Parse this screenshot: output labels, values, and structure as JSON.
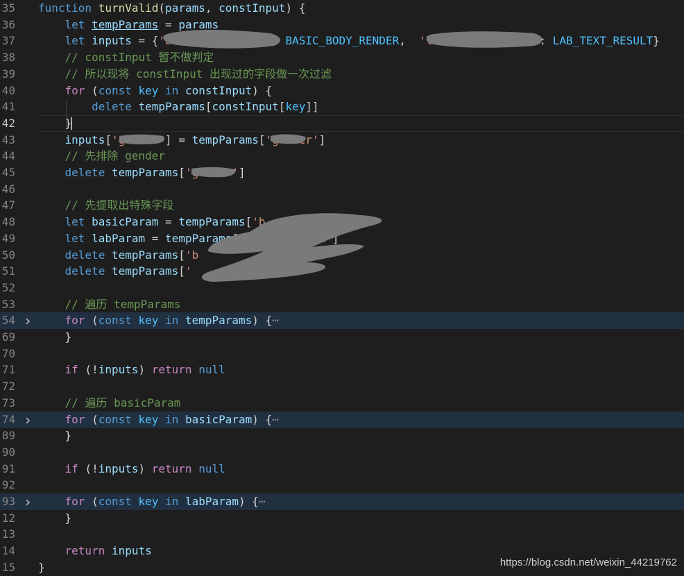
{
  "editor": {
    "lines": [
      {
        "no": "35",
        "tokens": [
          {
            "t": "function",
            "c": "kw"
          },
          {
            "t": " "
          },
          {
            "t": "turnValid",
            "c": "fn"
          },
          {
            "t": "("
          },
          {
            "t": "params",
            "c": "var"
          },
          {
            "t": ", "
          },
          {
            "t": "constInput",
            "c": "var"
          },
          {
            "t": ") {"
          }
        ]
      },
      {
        "no": "36",
        "tokens": [
          {
            "t": "    "
          },
          {
            "t": "let",
            "c": "kw"
          },
          {
            "t": " "
          },
          {
            "t": "tempParams",
            "c": "var",
            "u": true
          },
          {
            "t": " = "
          },
          {
            "t": "params",
            "c": "var"
          }
        ]
      },
      {
        "no": "37",
        "tokens": [
          {
            "t": "    "
          },
          {
            "t": "let",
            "c": "kw"
          },
          {
            "t": " "
          },
          {
            "t": "inputs",
            "c": "var"
          },
          {
            "t": " = {"
          },
          {
            "t": "'ba",
            "c": "str"
          },
          {
            "t": "              "
          },
          {
            "t": ": "
          },
          {
            "t": "BASIC_BODY_RENDER",
            "c": "cst"
          },
          {
            "t": ",  "
          },
          {
            "t": "'la",
            "c": "str"
          },
          {
            "t": "            "
          },
          {
            "t": "lt'",
            "c": "str"
          },
          {
            "t": ": "
          },
          {
            "t": "LAB_TEXT_RESULT",
            "c": "cst"
          },
          {
            "t": "}"
          }
        ]
      },
      {
        "no": "38",
        "tokens": [
          {
            "t": "    "
          },
          {
            "t": "// constInput 暂不做判定",
            "c": "cm"
          }
        ]
      },
      {
        "no": "39",
        "tokens": [
          {
            "t": "    "
          },
          {
            "t": "// 所以现将 constInput 出现过的字段做一次过滤",
            "c": "cm"
          }
        ]
      },
      {
        "no": "40",
        "tokens": [
          {
            "t": "    "
          },
          {
            "t": "for",
            "c": "ctl"
          },
          {
            "t": " ("
          },
          {
            "t": "const",
            "c": "kw"
          },
          {
            "t": " "
          },
          {
            "t": "key",
            "c": "cst"
          },
          {
            "t": " "
          },
          {
            "t": "in",
            "c": "kw"
          },
          {
            "t": " "
          },
          {
            "t": "constInput",
            "c": "var"
          },
          {
            "t": ") {"
          }
        ]
      },
      {
        "no": "41",
        "tokens": [
          {
            "t": "        "
          },
          {
            "t": "delete",
            "c": "kw"
          },
          {
            "t": " "
          },
          {
            "t": "tempParams",
            "c": "var"
          },
          {
            "t": "["
          },
          {
            "t": "constInput",
            "c": "var"
          },
          {
            "t": "["
          },
          {
            "t": "key",
            "c": "cst"
          },
          {
            "t": "]]"
          }
        ]
      },
      {
        "no": "42",
        "current": true,
        "tokens": [
          {
            "t": "    "
          },
          {
            "t": "}"
          },
          {
            "t": "",
            "cursor": true
          }
        ]
      },
      {
        "no": "43",
        "tokens": [
          {
            "t": "    "
          },
          {
            "t": "inputs",
            "c": "var"
          },
          {
            "t": "["
          },
          {
            "t": "'g",
            "c": "str"
          },
          {
            "t": "     "
          },
          {
            "t": "'",
            "c": "str"
          },
          {
            "t": "] = "
          },
          {
            "t": "tempParams",
            "c": "var"
          },
          {
            "t": "["
          },
          {
            "t": "'g",
            "c": "str"
          },
          {
            "t": "   "
          },
          {
            "t": "er'",
            "c": "str"
          },
          {
            "t": "]"
          }
        ]
      },
      {
        "no": "44",
        "tokens": [
          {
            "t": "    "
          },
          {
            "t": "// 先排除 gender",
            "c": "cm"
          }
        ]
      },
      {
        "no": "45",
        "tokens": [
          {
            "t": "    "
          },
          {
            "t": "delete",
            "c": "kw"
          },
          {
            "t": " "
          },
          {
            "t": "tempParams",
            "c": "var"
          },
          {
            "t": "["
          },
          {
            "t": "'ge",
            "c": "str"
          },
          {
            "t": "    "
          },
          {
            "t": "'",
            "c": "str"
          },
          {
            "t": "]"
          }
        ]
      },
      {
        "no": "46",
        "tokens": []
      },
      {
        "no": "47",
        "tokens": [
          {
            "t": "    "
          },
          {
            "t": "// 先提取出特殊字段",
            "c": "cm"
          }
        ]
      },
      {
        "no": "48",
        "tokens": [
          {
            "t": "    "
          },
          {
            "t": "let",
            "c": "kw"
          },
          {
            "t": " "
          },
          {
            "t": "basicParam",
            "c": "var"
          },
          {
            "t": " = "
          },
          {
            "t": "tempParams",
            "c": "var"
          },
          {
            "t": "["
          },
          {
            "t": "'b",
            "c": "str"
          },
          {
            "t": "           "
          },
          {
            "t": "r'",
            "c": "str"
          },
          {
            "t": "]"
          }
        ]
      },
      {
        "no": "49",
        "tokens": [
          {
            "t": "    "
          },
          {
            "t": "let",
            "c": "kw"
          },
          {
            "t": " "
          },
          {
            "t": "labParam",
            "c": "var"
          },
          {
            "t": " = "
          },
          {
            "t": "tempParams",
            "c": "var"
          },
          {
            "t": "["
          },
          {
            "t": "'l",
            "c": "str"
          },
          {
            "t": "         "
          },
          {
            "t": "lt'",
            "c": "str"
          },
          {
            "t": "]"
          }
        ]
      },
      {
        "no": "50",
        "tokens": [
          {
            "t": "    "
          },
          {
            "t": "delete",
            "c": "kw"
          },
          {
            "t": " "
          },
          {
            "t": "tempParams",
            "c": "var"
          },
          {
            "t": "["
          },
          {
            "t": "'b",
            "c": "str"
          },
          {
            "t": "           "
          },
          {
            "t": "'",
            "c": "str"
          },
          {
            "t": "]"
          }
        ]
      },
      {
        "no": "51",
        "tokens": [
          {
            "t": "    "
          },
          {
            "t": "delete",
            "c": "kw"
          },
          {
            "t": " "
          },
          {
            "t": "tempParams",
            "c": "var"
          },
          {
            "t": "["
          },
          {
            "t": "'",
            "c": "str"
          },
          {
            "t": "         "
          },
          {
            "t": "t'",
            "c": "str"
          },
          {
            "t": "]"
          }
        ]
      },
      {
        "no": "52",
        "tokens": []
      },
      {
        "no": "53",
        "tokens": [
          {
            "t": "    "
          },
          {
            "t": "// 遍历 tempParams",
            "c": "cm"
          }
        ]
      },
      {
        "no": "54",
        "folded": true,
        "tokens": [
          {
            "t": "    "
          },
          {
            "t": "for",
            "c": "ctl"
          },
          {
            "t": " ("
          },
          {
            "t": "const",
            "c": "kw"
          },
          {
            "t": " "
          },
          {
            "t": "key",
            "c": "cst"
          },
          {
            "t": " "
          },
          {
            "t": "in",
            "c": "kw"
          },
          {
            "t": " "
          },
          {
            "t": "tempParams",
            "c": "var"
          },
          {
            "t": ") {"
          },
          {
            "t": "⋯",
            "c": "ellip"
          }
        ]
      },
      {
        "no": "69",
        "tokens": [
          {
            "t": "    "
          },
          {
            "t": "}"
          }
        ]
      },
      {
        "no": "70",
        "tokens": []
      },
      {
        "no": "71",
        "tokens": [
          {
            "t": "    "
          },
          {
            "t": "if",
            "c": "ctl"
          },
          {
            "t": " (!"
          },
          {
            "t": "inputs",
            "c": "var"
          },
          {
            "t": ") "
          },
          {
            "t": "return",
            "c": "ctl"
          },
          {
            "t": " "
          },
          {
            "t": "null",
            "c": "kw"
          }
        ]
      },
      {
        "no": "72",
        "tokens": []
      },
      {
        "no": "73",
        "tokens": [
          {
            "t": "    "
          },
          {
            "t": "// 遍历 basicParam",
            "c": "cm"
          }
        ]
      },
      {
        "no": "74",
        "folded": true,
        "tokens": [
          {
            "t": "    "
          },
          {
            "t": "for",
            "c": "ctl"
          },
          {
            "t": " ("
          },
          {
            "t": "const",
            "c": "kw"
          },
          {
            "t": " "
          },
          {
            "t": "key",
            "c": "cst"
          },
          {
            "t": " "
          },
          {
            "t": "in",
            "c": "kw"
          },
          {
            "t": " "
          },
          {
            "t": "basicParam",
            "c": "var"
          },
          {
            "t": ") {"
          },
          {
            "t": "⋯",
            "c": "ellip"
          }
        ]
      },
      {
        "no": "89",
        "tokens": [
          {
            "t": "    "
          },
          {
            "t": "}"
          }
        ]
      },
      {
        "no": "90",
        "tokens": []
      },
      {
        "no": "91",
        "tokens": [
          {
            "t": "    "
          },
          {
            "t": "if",
            "c": "ctl"
          },
          {
            "t": " (!"
          },
          {
            "t": "inputs",
            "c": "var"
          },
          {
            "t": ") "
          },
          {
            "t": "return",
            "c": "ctl"
          },
          {
            "t": " "
          },
          {
            "t": "null",
            "c": "kw"
          }
        ]
      },
      {
        "no": "92",
        "tokens": []
      },
      {
        "no": "93",
        "folded": true,
        "tokens": [
          {
            "t": "    "
          },
          {
            "t": "for",
            "c": "ctl"
          },
          {
            "t": " ("
          },
          {
            "t": "const",
            "c": "kw"
          },
          {
            "t": " "
          },
          {
            "t": "key",
            "c": "cst"
          },
          {
            "t": " "
          },
          {
            "t": "in",
            "c": "kw"
          },
          {
            "t": " "
          },
          {
            "t": "labParam",
            "c": "var"
          },
          {
            "t": ") {"
          },
          {
            "t": "⋯",
            "c": "ellip"
          }
        ]
      },
      {
        "no": "12",
        "tokens": [
          {
            "t": "    "
          },
          {
            "t": "}"
          }
        ]
      },
      {
        "no": "13",
        "tokens": []
      },
      {
        "no": "14",
        "tokens": [
          {
            "t": "    "
          },
          {
            "t": "return",
            "c": "ctl"
          },
          {
            "t": " "
          },
          {
            "t": "inputs",
            "c": "var"
          }
        ]
      },
      {
        "no": "15",
        "tokens": [
          {
            "t": "}"
          }
        ]
      }
    ],
    "fold_icon": "chevron-right-icon"
  },
  "watermark": "https://blog.csdn.net/weixin_44219762",
  "colors": {
    "background": "#1e1e1e",
    "keyword": "#569cd6",
    "control": "#c586c0",
    "function": "#dcdcaa",
    "variable": "#9cdcfe",
    "string": "#ce9178",
    "comment": "#6a9955",
    "constant": "#4fc1ff",
    "redaction": "#7a7a7a"
  }
}
